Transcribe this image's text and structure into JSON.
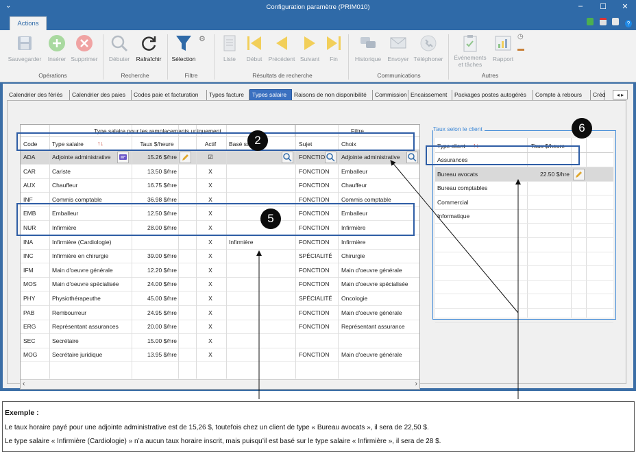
{
  "window": {
    "title": "Configuration paramètre (PRIM010)"
  },
  "ribbon_tab": "Actions",
  "ribbon": {
    "save": "Sauvegarder",
    "insert": "Insérer",
    "delete": "Supprimer",
    "group_ops": "Opérations",
    "start": "Débuter",
    "refresh": "Rafraîchir",
    "group_search": "Recherche",
    "selection": "Sélection",
    "group_filter": "Filtre",
    "list": "Liste",
    "first": "Début",
    "prev": "Précédent",
    "next": "Suivant",
    "end": "Fin",
    "group_results": "Résultats de recherche",
    "history": "Historique",
    "send": "Envoyer",
    "phone": "Téléphoner",
    "group_comm": "Communications",
    "events1": "Événements",
    "events2": "et tâches",
    "report": "Rapport",
    "group_other": "Autres"
  },
  "tabs": [
    "Calendrier des fériés",
    "Calendrier des paies",
    "Codes paie et facturation",
    "Types facture",
    "Types salaire",
    "Raisons de non disponibilité",
    "Commission",
    "Encaissement",
    "Packages postes autogérés",
    "Compte à rebours",
    "Créd"
  ],
  "grid": {
    "group_left": "Type salaire pour les remplacements uniquement",
    "group_right": "Filtre",
    "headers": {
      "code": "Code",
      "type": "Type salaire",
      "rate": "Taux $/heure",
      "active": "Actif",
      "based": "Basé sur",
      "subject": "Sujet",
      "choice": "Choix"
    },
    "rows": [
      {
        "code": "ADA",
        "type": "Adjointe administrative",
        "rate": "15.26 $/hre",
        "active": "☑",
        "based": "",
        "subject": "FONCTIO",
        "choice": "Adjointe administrative"
      },
      {
        "code": "CAR",
        "type": "Cariste",
        "rate": "13.50 $/hre",
        "active": "X",
        "based": "",
        "subject": "FONCTION",
        "choice": "Emballeur"
      },
      {
        "code": "AUX",
        "type": "Chauffeur",
        "rate": "16.75 $/hre",
        "active": "X",
        "based": "",
        "subject": "FONCTION",
        "choice": "Chauffeur"
      },
      {
        "code": "INF",
        "type": "Commis comptable",
        "rate": "36.98 $/hre",
        "active": "X",
        "based": "",
        "subject": "FONCTION",
        "choice": "Commis comptable"
      },
      {
        "code": "EMB",
        "type": "Emballeur",
        "rate": "12.50 $/hre",
        "active": "X",
        "based": "",
        "subject": "FONCTION",
        "choice": "Emballeur"
      },
      {
        "code": "NUR",
        "type": "Infirmière",
        "rate": "28.00 $/hre",
        "active": "X",
        "based": "",
        "subject": "FONCTION",
        "choice": "Infirmière"
      },
      {
        "code": "INA",
        "type": "Infirmière (Cardiologie)",
        "rate": "",
        "active": "X",
        "based": "Infirmière",
        "subject": "FONCTION",
        "choice": "Infirmière"
      },
      {
        "code": "INC",
        "type": "Infirmière en chirurgie",
        "rate": "39.00 $/hre",
        "active": "X",
        "based": "",
        "subject": "SPÉCIALITÉ",
        "choice": "Chirurgie"
      },
      {
        "code": "IFM",
        "type": "Main d'oeuvre générale",
        "rate": "12.20 $/hre",
        "active": "X",
        "based": "",
        "subject": "FONCTION",
        "choice": "Main d'oeuvre générale"
      },
      {
        "code": "MOS",
        "type": "Main d'oeuvre spécialisée",
        "rate": "24.00 $/hre",
        "active": "X",
        "based": "",
        "subject": "FONCTION",
        "choice": "Main d'oeuvre spécialisée"
      },
      {
        "code": "PHY",
        "type": "Physiothérapeuthe",
        "rate": "45.00 $/hre",
        "active": "X",
        "based": "",
        "subject": "SPÉCIALITÉ",
        "choice": "Oncologie"
      },
      {
        "code": "PAB",
        "type": "Rembourreur",
        "rate": "24.95 $/hre",
        "active": "X",
        "based": "",
        "subject": "FONCTION",
        "choice": "Main d'oeuvre générale"
      },
      {
        "code": "ERG",
        "type": "Représentant assurances",
        "rate": "20.00 $/hre",
        "active": "X",
        "based": "",
        "subject": "FONCTION",
        "choice": "Représentant assurance"
      },
      {
        "code": "SEC",
        "type": "Secrétaire",
        "rate": "15.00 $/hre",
        "active": "X",
        "based": "",
        "subject": "",
        "choice": ""
      },
      {
        "code": "MOG",
        "type": "Secrétaire juridique",
        "rate": "13.95 $/hre",
        "active": "X",
        "based": "",
        "subject": "FONCTION",
        "choice": "Main d'oeuvre générale"
      }
    ]
  },
  "client_rates": {
    "legend": "Taux selon le client",
    "headers": {
      "type": "Type client",
      "rate": "Taux $/heure"
    },
    "rows": [
      {
        "type": "Assurances",
        "rate": ""
      },
      {
        "type": "Bureau avocats",
        "rate": "22.50 $/hre"
      },
      {
        "type": "Bureau comptables",
        "rate": ""
      },
      {
        "type": "Commercial",
        "rate": ""
      },
      {
        "type": "Informatique",
        "rate": ""
      }
    ]
  },
  "badges": {
    "b2": "2",
    "b5": "5",
    "b6": "6"
  },
  "note": {
    "title": "Exemple :",
    "line1": "Le taux horaire payé pour une adjointe administrative est de 15,26 $, toutefois chez un client de type « Bureau avocats », il sera de 22,50 $.",
    "line2": "Le type salaire « Infirmière (Cardiologie) » n’a aucun taux horaire inscrit, mais puisqu’il est basé sur le type salaire « Infirmière », il sera de 28 $."
  },
  "colors": {
    "accent": "#2f6aa8",
    "highlight": "#2e5da5",
    "selected_tab": "#3a70c0"
  }
}
